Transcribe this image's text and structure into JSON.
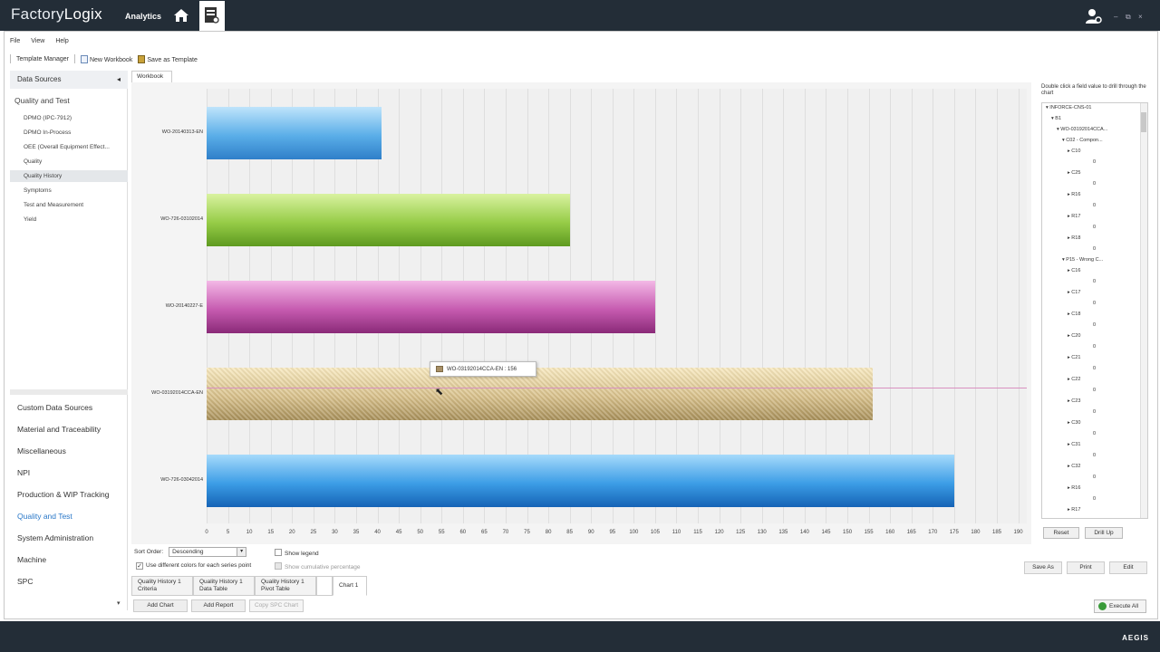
{
  "app": {
    "brand": "FactoryLogix",
    "module": "Analytics",
    "footer_logo": "AEGIS"
  },
  "colors": {
    "topbar": "#232d37",
    "accent": "#2a78c8",
    "bar_blue": "#4a9ee0",
    "bar_green": "#8cc63f",
    "bar_magenta": "#b84aa0",
    "bar_tan": "#c9b07a",
    "bar_blue2": "#2f8fdc"
  },
  "menu": [
    "File",
    "View",
    "Help"
  ],
  "toolbar": {
    "template_manager": "Template Manager",
    "new_workbook": "New Workbook",
    "save_as_template": "Save as Template"
  },
  "left": {
    "data_sources": "Data Sources",
    "section": "Quality and Test",
    "items": [
      "DPMO (IPC-7912)",
      "DPMO In-Process",
      "OEE (Overall Equipment Effect...",
      "Quality",
      "Quality History",
      "Symptoms",
      "Test and Measurement",
      "Yield"
    ],
    "modules": [
      "Custom Data Sources",
      "Material and Traceability",
      "Miscellaneous",
      "NPI",
      "Production & WIP Tracking",
      "Quality and Test",
      "System Administration",
      "Machine",
      "SPC"
    ]
  },
  "workbook_tab": "Workbook",
  "chart_data": {
    "type": "bar",
    "orientation": "horizontal",
    "categories": [
      "WO-20140313-EN",
      "WO-726-03102014",
      "WO-20140227-E",
      "WO-03192014CCA-EN",
      "WO-726-03042014"
    ],
    "values": [
      41,
      85,
      105,
      156,
      175
    ],
    "xlim": [
      0,
      192
    ],
    "xticks": [
      0,
      5,
      10,
      15,
      20,
      25,
      30,
      35,
      40,
      45,
      50,
      55,
      60,
      65,
      70,
      75,
      80,
      85,
      90,
      95,
      100,
      105,
      110,
      115,
      120,
      125,
      130,
      135,
      140,
      145,
      150,
      155,
      160,
      165,
      170,
      175,
      180,
      185,
      190
    ],
    "grid": true
  },
  "tooltip": {
    "text": "WO-03192014CCA-EN : 156"
  },
  "options": {
    "sort_label": "Sort Order:",
    "sort_value": "Descending",
    "show_legend": "Show legend",
    "diff_colors": "Use different colors for each series point",
    "cumulative": "Show cumulative percentage"
  },
  "sheet_tabs": [
    {
      "l1": "Quality History 1",
      "l2": "Criteria"
    },
    {
      "l1": "Quality History 1",
      "l2": "Data Table"
    },
    {
      "l1": "Quality History 1",
      "l2": "Pivot Table"
    }
  ],
  "active_sheet": "Chart 1",
  "buttons": {
    "add_chart": "Add Chart",
    "add_report": "Add Report",
    "copy_spc": "Copy SPC Chart",
    "execute_all": "Execute All",
    "save_as": "Save As",
    "print": "Print",
    "edit": "Edit",
    "reset": "Reset",
    "drill_up": "Drill Up"
  },
  "right": {
    "hint": "Double click a field value to drill through the chart",
    "tree": [
      {
        "t": "INFORCE-CNS-01",
        "lvl": 0,
        "exp": "▾"
      },
      {
        "t": "B1",
        "lvl": 1,
        "exp": "▾"
      },
      {
        "t": "WO-03192014CCA...",
        "lvl": 2,
        "exp": "▾"
      },
      {
        "t": "C02 - Compon...",
        "lvl": 3,
        "exp": "▾"
      },
      {
        "t": "C10",
        "lvl": 4,
        "exp": "▸"
      },
      {
        "t": "0",
        "lvl": 5
      },
      {
        "t": "C25",
        "lvl": 4,
        "exp": "▸"
      },
      {
        "t": "0",
        "lvl": 5
      },
      {
        "t": "R16",
        "lvl": 4,
        "exp": "▸"
      },
      {
        "t": "0",
        "lvl": 5
      },
      {
        "t": "R17",
        "lvl": 4,
        "exp": "▸"
      },
      {
        "t": "0",
        "lvl": 5
      },
      {
        "t": "R18",
        "lvl": 4,
        "exp": "▸"
      },
      {
        "t": "0",
        "lvl": 5
      },
      {
        "t": "P15 - Wrong C...",
        "lvl": 3,
        "exp": "▾"
      },
      {
        "t": "C16",
        "lvl": 4,
        "exp": "▸"
      },
      {
        "t": "0",
        "lvl": 5
      },
      {
        "t": "C17",
        "lvl": 4,
        "exp": "▸"
      },
      {
        "t": "0",
        "lvl": 5
      },
      {
        "t": "C18",
        "lvl": 4,
        "exp": "▸"
      },
      {
        "t": "0",
        "lvl": 5
      },
      {
        "t": "C20",
        "lvl": 4,
        "exp": "▸"
      },
      {
        "t": "0",
        "lvl": 5
      },
      {
        "t": "C21",
        "lvl": 4,
        "exp": "▸"
      },
      {
        "t": "0",
        "lvl": 5
      },
      {
        "t": "C22",
        "lvl": 4,
        "exp": "▸"
      },
      {
        "t": "0",
        "lvl": 5
      },
      {
        "t": "C23",
        "lvl": 4,
        "exp": "▸"
      },
      {
        "t": "0",
        "lvl": 5
      },
      {
        "t": "C30",
        "lvl": 4,
        "exp": "▸"
      },
      {
        "t": "0",
        "lvl": 5
      },
      {
        "t": "C31",
        "lvl": 4,
        "exp": "▸"
      },
      {
        "t": "0",
        "lvl": 5
      },
      {
        "t": "C32",
        "lvl": 4,
        "exp": "▸"
      },
      {
        "t": "0",
        "lvl": 5
      },
      {
        "t": "R16",
        "lvl": 4,
        "exp": "▸"
      },
      {
        "t": "0",
        "lvl": 5
      },
      {
        "t": "R17",
        "lvl": 4,
        "exp": "▸"
      }
    ]
  }
}
